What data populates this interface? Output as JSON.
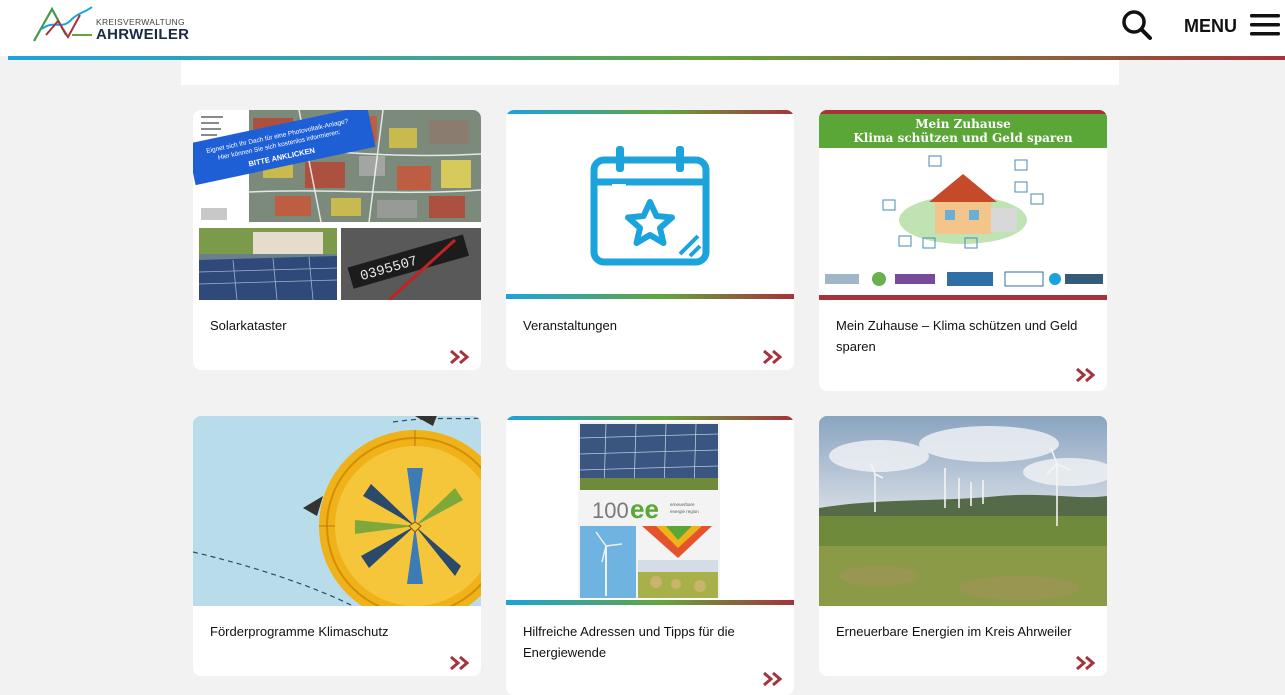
{
  "header": {
    "logo_top": "KREISVERWALTUNG",
    "logo_bottom": "AHRWEILER",
    "menu_label": "MENU",
    "search_icon": "search-icon",
    "menu_icon": "hamburger-icon"
  },
  "colors": {
    "accent_red": "#a6323b",
    "accent_blue": "#1ba3dc",
    "accent_green": "#64a53b",
    "background": "#f2f2f2"
  },
  "cards": [
    {
      "title": "Solarkataster",
      "arrow_icon": "double-chevron-right-icon",
      "image_text": [
        "Eignet sich Ihr Dach für eine Photovoltaik-Anlage?",
        "Hier können Sie sich kostenlos informieren:",
        "BITTE ANKLICKEN"
      ]
    },
    {
      "title": "Veranstaltungen",
      "arrow_icon": "double-chevron-right-icon",
      "image_icon": "calendar-star-icon"
    },
    {
      "title": "Mein Zuhause – Klima schützen und Geld sparen",
      "arrow_icon": "double-chevron-right-icon",
      "image_text": [
        "Mein Zuhause",
        "Klima schützen und Geld sparen"
      ]
    },
    {
      "title": "Förderprogramme Klimaschutz",
      "arrow_icon": "double-chevron-right-icon",
      "image_icon": "compass-icon"
    },
    {
      "title": "Hilfreiche Adressen und Tipps für die Energiewende",
      "arrow_icon": "double-chevron-right-icon",
      "image_text": [
        "100",
        "ee",
        "erneuerbare",
        "energie region"
      ]
    },
    {
      "title": "Erneuerbare Energien im Kreis Ahrweiler",
      "arrow_icon": "double-chevron-right-icon"
    }
  ]
}
